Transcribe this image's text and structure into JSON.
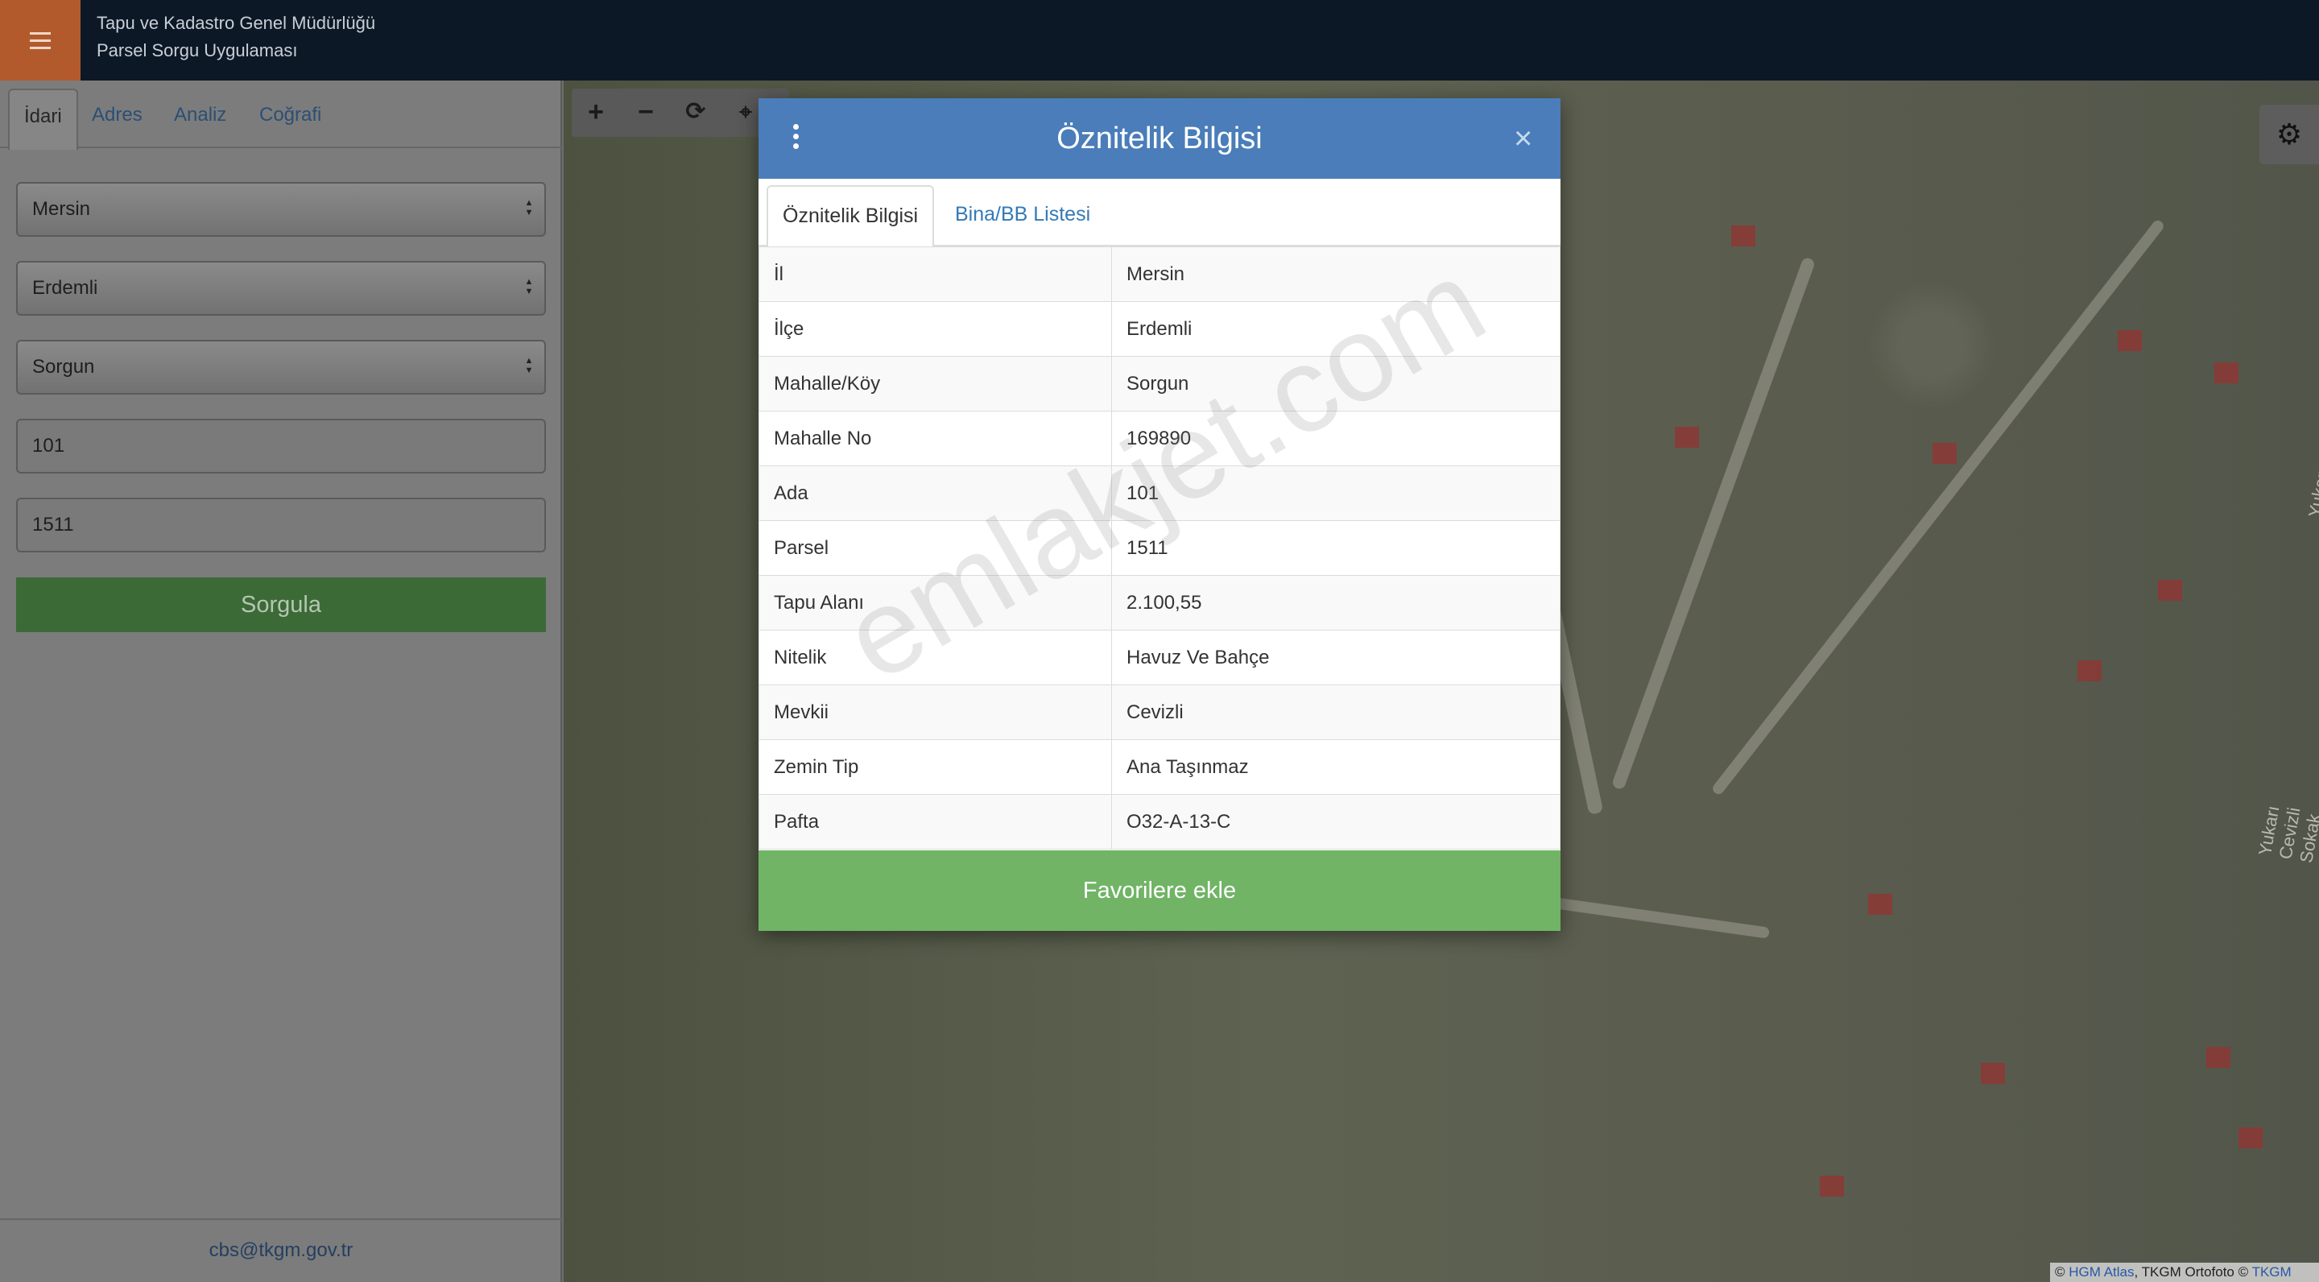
{
  "header": {
    "org_name": "Tapu ve Kadastro Genel Müdürlüğü",
    "app_name": "Parsel Sorgu Uygulaması",
    "menu_icon": "hamburger-icon"
  },
  "sidebar": {
    "tabs": [
      "İdari",
      "Adres",
      "Analiz",
      "Coğrafi"
    ],
    "active_tab": "İdari",
    "selects": {
      "il": "Mersin",
      "ilce": "Erdemli",
      "mahalle": "Sorgun"
    },
    "inputs": {
      "ada": "101",
      "parsel": "1511"
    },
    "query_button": "Sorgula",
    "footer_email": "cbs@tkgm.gov.tr"
  },
  "map": {
    "tools": [
      "plus-icon",
      "minus-icon",
      "refresh-icon",
      "crosshair-icon"
    ],
    "settings_icon": "gear-icon",
    "street_labels": [
      "Yukarı Cevizli Sokak",
      "Yukarı Cevizli Sokak"
    ],
    "attribution": {
      "prefix": "© ",
      "hgm_link": "HGM Atlas",
      "middle": ", TKGM Ortofoto © ",
      "tkgm_link": "TKGM"
    }
  },
  "modal": {
    "title": "Öznitelik Bilgisi",
    "close_label": "×",
    "menu_icon": "vertical-dots-icon",
    "tabs": [
      "Öznitelik Bilgisi",
      "Bina/BB Listesi"
    ],
    "active_tab": "Öznitelik Bilgisi",
    "rows": [
      {
        "key": "İl",
        "value": "Mersin"
      },
      {
        "key": "İlçe",
        "value": "Erdemli"
      },
      {
        "key": "Mahalle/Köy",
        "value": "Sorgun"
      },
      {
        "key": "Mahalle No",
        "value": "169890"
      },
      {
        "key": "Ada",
        "value": "101"
      },
      {
        "key": "Parsel",
        "value": "1511"
      },
      {
        "key": "Tapu Alanı",
        "value": "2.100,55"
      },
      {
        "key": "Nitelik",
        "value": "Havuz Ve Bahçe"
      },
      {
        "key": "Mevkii",
        "value": "Cevizli"
      },
      {
        "key": "Zemin Tip",
        "value": "Ana Taşınmaz"
      },
      {
        "key": "Pafta",
        "value": "O32-A-13-C"
      }
    ],
    "favorite_button": "Favorilere ekle"
  },
  "watermark": "emlakjet.com"
}
